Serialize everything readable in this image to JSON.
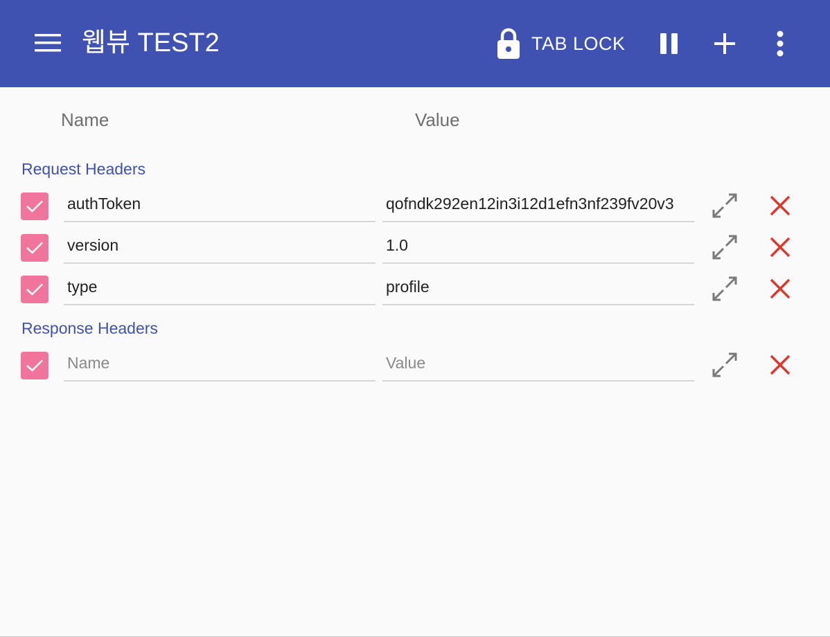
{
  "app_bar": {
    "title": "웹뷰 TEST2",
    "tab_lock_label": "TAB LOCK",
    "menu_icon": "hamburger-menu-icon",
    "lock_icon": "lock-icon",
    "pause_icon": "pause-icon",
    "add_icon": "plus-icon",
    "more_icon": "more-vertical-icon",
    "background_color": "#3f51b1"
  },
  "columns": {
    "name": "Name",
    "value": "Value"
  },
  "sections": {
    "request": {
      "label": "Request Headers",
      "rows": [
        {
          "checked": true,
          "name": "authToken",
          "value": "qofndk292en12in3i12d1efn3nf239fv20v3"
        },
        {
          "checked": true,
          "name": "version",
          "value": "1.0"
        },
        {
          "checked": true,
          "name": "type",
          "value": "profile"
        }
      ]
    },
    "response": {
      "label": "Response Headers",
      "rows": [
        {
          "checked": true,
          "name_placeholder": "Name",
          "value_placeholder": "Value"
        }
      ]
    }
  },
  "colors": {
    "accent": "#3f51b1",
    "checkbox": "#f0749b",
    "delete": "#e0352b",
    "expand": "#7a7a7a"
  }
}
